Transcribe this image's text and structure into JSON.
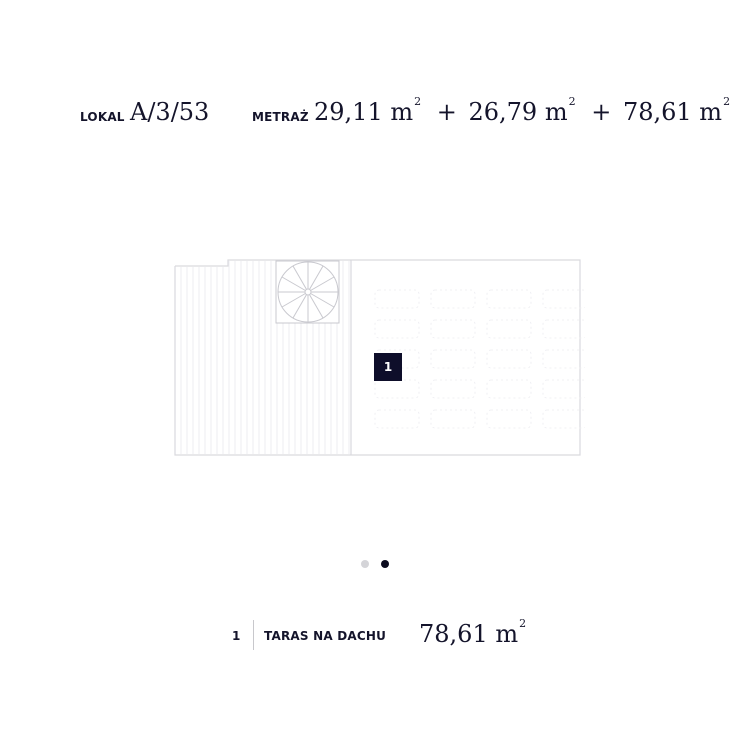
{
  "header": {
    "lokal_label": "LOKAL",
    "lokal_value": "A/3/53",
    "metraz_label": "METRAŻ",
    "areas": [
      {
        "value": "29,11 m",
        "unit_sup": "2"
      },
      {
        "value": "26,79 m",
        "unit_sup": "2"
      },
      {
        "value": "78,61 m",
        "unit_sup": "2"
      }
    ],
    "separator": "+"
  },
  "floorplan": {
    "room_marker": "1",
    "line_color": "#d9d9de"
  },
  "pager": {
    "active_index": 1,
    "count": 2
  },
  "legend": {
    "number": "1",
    "name": "TARAS NA DACHU",
    "area": "78,61 m",
    "area_sup": "2"
  },
  "colors": {
    "text": "#14142b",
    "marker_bg": "#0e0e2a",
    "dot_inactive": "#d4d4d8",
    "dot_active": "#0b0b1e"
  }
}
